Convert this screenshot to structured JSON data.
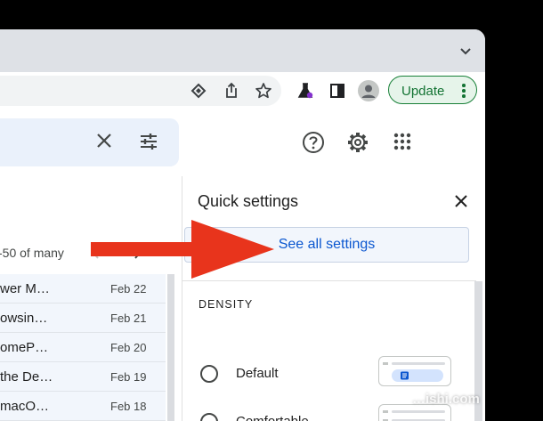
{
  "browser": {
    "toolbar_icons": [
      "install-app-icon",
      "share-icon",
      "bookmark-star-icon",
      "labs-flask-icon",
      "side-panel-icon",
      "profile-avatar-icon"
    ],
    "update_label": "Update",
    "update_color": "#188038"
  },
  "gmail": {
    "header_icons": [
      "close-icon",
      "search-options-icon",
      "help-icon",
      "settings-gear-icon",
      "apps-grid-icon"
    ],
    "pager": "-50 of many",
    "rows": [
      {
        "subject": "wer M…",
        "date": "Feb 22"
      },
      {
        "subject": "owsin…",
        "date": "Feb 21"
      },
      {
        "subject": "omeP…",
        "date": "Feb 20"
      },
      {
        "subject": "the De…",
        "date": "Feb 19"
      },
      {
        "subject": " macO…",
        "date": "Feb 18"
      }
    ]
  },
  "quick_settings": {
    "title": "Quick settings",
    "see_all": "See all settings",
    "density_heading": "DENSITY",
    "options": [
      {
        "label": "Default",
        "selected": false
      },
      {
        "label": "Comfortable",
        "selected": false
      }
    ]
  },
  "annotation": {
    "arrow_color": "#e8341c"
  },
  "watermark": "…ishi.com"
}
